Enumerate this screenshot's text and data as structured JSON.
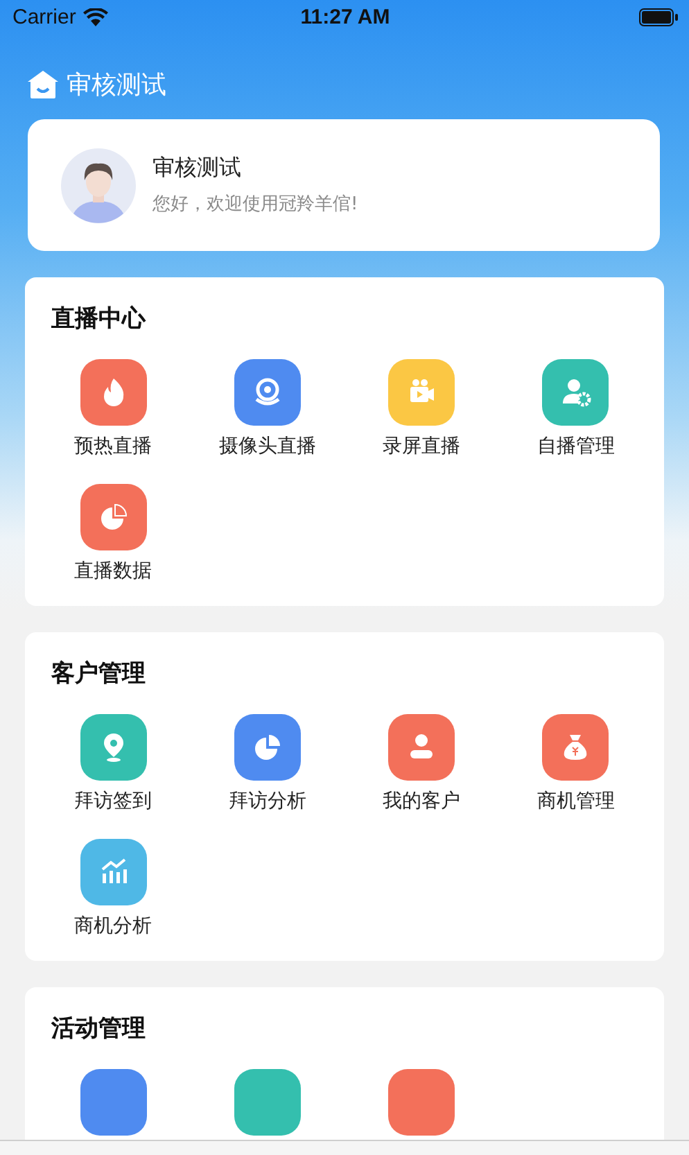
{
  "status_bar": {
    "carrier": "Carrier",
    "time": "11:27 AM"
  },
  "header": {
    "title": "审核测试"
  },
  "profile": {
    "name": "审核测试",
    "greeting": "您好，欢迎使用冠羚羊倌!"
  },
  "sections": [
    {
      "title": "直播中心",
      "items": [
        {
          "label": "预热直播",
          "kind": "flame",
          "color": "#f3705a"
        },
        {
          "label": "摄像头直播",
          "kind": "webcam",
          "color": "#4f8bf0"
        },
        {
          "label": "录屏直播",
          "kind": "video",
          "color": "#fbc744"
        },
        {
          "label": "自播管理",
          "kind": "user-gear",
          "color": "#34bfae"
        },
        {
          "label": "直播数据",
          "kind": "pie-hatch",
          "color": "#f3705a"
        }
      ]
    },
    {
      "title": "客户管理",
      "items": [
        {
          "label": "拜访签到",
          "kind": "pin",
          "color": "#34bfae"
        },
        {
          "label": "拜访分析",
          "kind": "pie",
          "color": "#4f8bf0"
        },
        {
          "label": "我的客户",
          "kind": "user",
          "color": "#f3705a"
        },
        {
          "label": "商机管理",
          "kind": "moneybag",
          "color": "#f3705a"
        },
        {
          "label": "商机分析",
          "kind": "bars",
          "color": "#4fb8e6"
        }
      ]
    },
    {
      "title": "活动管理",
      "items": [
        {
          "kind": "blank",
          "color": "#4f8bf0"
        },
        {
          "kind": "blank",
          "color": "#34bfae"
        },
        {
          "kind": "blank",
          "color": "#f3705a"
        }
      ]
    }
  ]
}
